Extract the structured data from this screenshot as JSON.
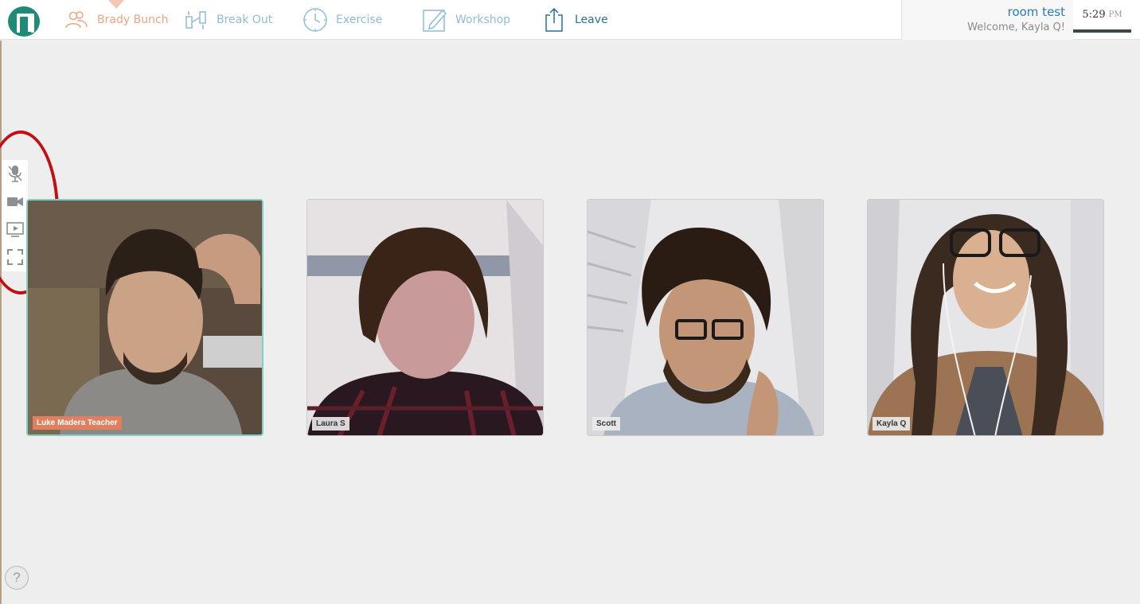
{
  "nav": {
    "brady_bunch": "Brady Bunch",
    "break_out": "Break Out",
    "exercise": "Exercise",
    "workshop": "Workshop",
    "leave": "Leave"
  },
  "room": {
    "title": "room test",
    "welcome": "Welcome, Kayla Q!"
  },
  "clock": {
    "time": "5:29",
    "ampm": "PM"
  },
  "toolbar": {
    "icons": [
      "microphone-icon",
      "camera-icon",
      "screen-share-icon",
      "fullscreen-icon"
    ]
  },
  "participants": [
    {
      "name": "Luke Madera Teacher",
      "speaking": true
    },
    {
      "name": "Laura S",
      "speaking": false
    },
    {
      "name": "Scott",
      "speaking": false
    },
    {
      "name": "Kayla Q",
      "speaking": false
    }
  ],
  "help": {
    "label": "?"
  },
  "colors": {
    "brand": "#1f8a78",
    "active_nav": "#e8a684",
    "nav": "#8fbcd6",
    "leave": "#2a6f9c",
    "speaking_border": "#7ed1c3",
    "teacher_label": "#e07f5e",
    "annotation": "#c20f12"
  }
}
